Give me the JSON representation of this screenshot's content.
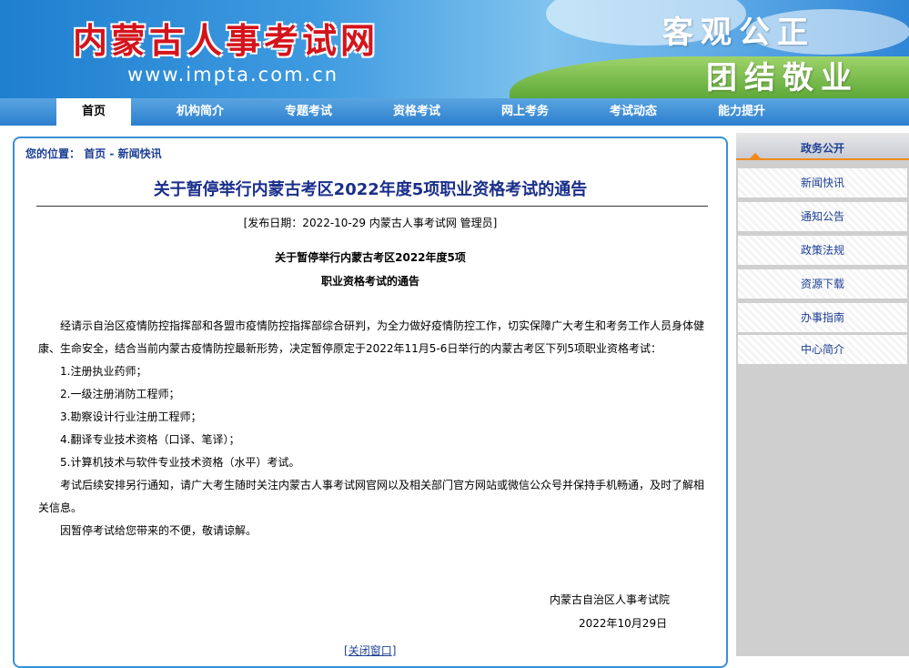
{
  "header": {
    "logo": "内蒙古人事考试网",
    "url": "www.impta.com.cn",
    "slogan_line1": "客观公正",
    "slogan_line2": "团结敬业"
  },
  "nav": [
    "首页",
    "机构简介",
    "专题考试",
    "资格考试",
    "网上考务",
    "考试动态",
    "能力提升"
  ],
  "breadcrumb": {
    "prefix": "您的位置：",
    "home": "首页",
    "sep": " - ",
    "current": "新闻快讯"
  },
  "article": {
    "title": "关于暂停举行内蒙古考区2022年度5项职业资格考试的通告",
    "meta": "[发布日期：2022-10-29 内蒙古人事考试网 管理员]",
    "subtitle_line1": "关于暂停举行内蒙古考区2022年度5项",
    "subtitle_line2": "职业资格考试的通告",
    "paragraphs": [
      "经请示自治区疫情防控指挥部和各盟市疫情防控指挥部综合研判，为全力做好疫情防控工作，切实保障广大考生和考务工作人员身体健康、生命安全，结合当前内蒙古疫情防控最新形势，决定暂停原定于2022年11月5-6日举行的内蒙古考区下列5项职业资格考试：",
      "1.注册执业药师；",
      "2.一级注册消防工程师；",
      "3.勘察设计行业注册工程师；",
      "4.翻译专业技术资格（口译、笔译）；",
      "5.计算机技术与软件专业技术资格（水平）考试。",
      "考试后续安排另行通知，请广大考生随时关注内蒙古人事考试网官网以及相关部门官方网站或微信公众号并保持手机畅通，及时了解相关信息。",
      "因暂停考试给您带来的不便，敬请谅解。"
    ],
    "signature_org": "内蒙古自治区人事考试院",
    "signature_date": "2022年10月29日",
    "close_window": "关闭窗口"
  },
  "sidebar": {
    "heading": "政务公开",
    "items": [
      "新闻快讯",
      "通知公告",
      "政策法规",
      "资源下载",
      "办事指南",
      "中心简介"
    ]
  }
}
